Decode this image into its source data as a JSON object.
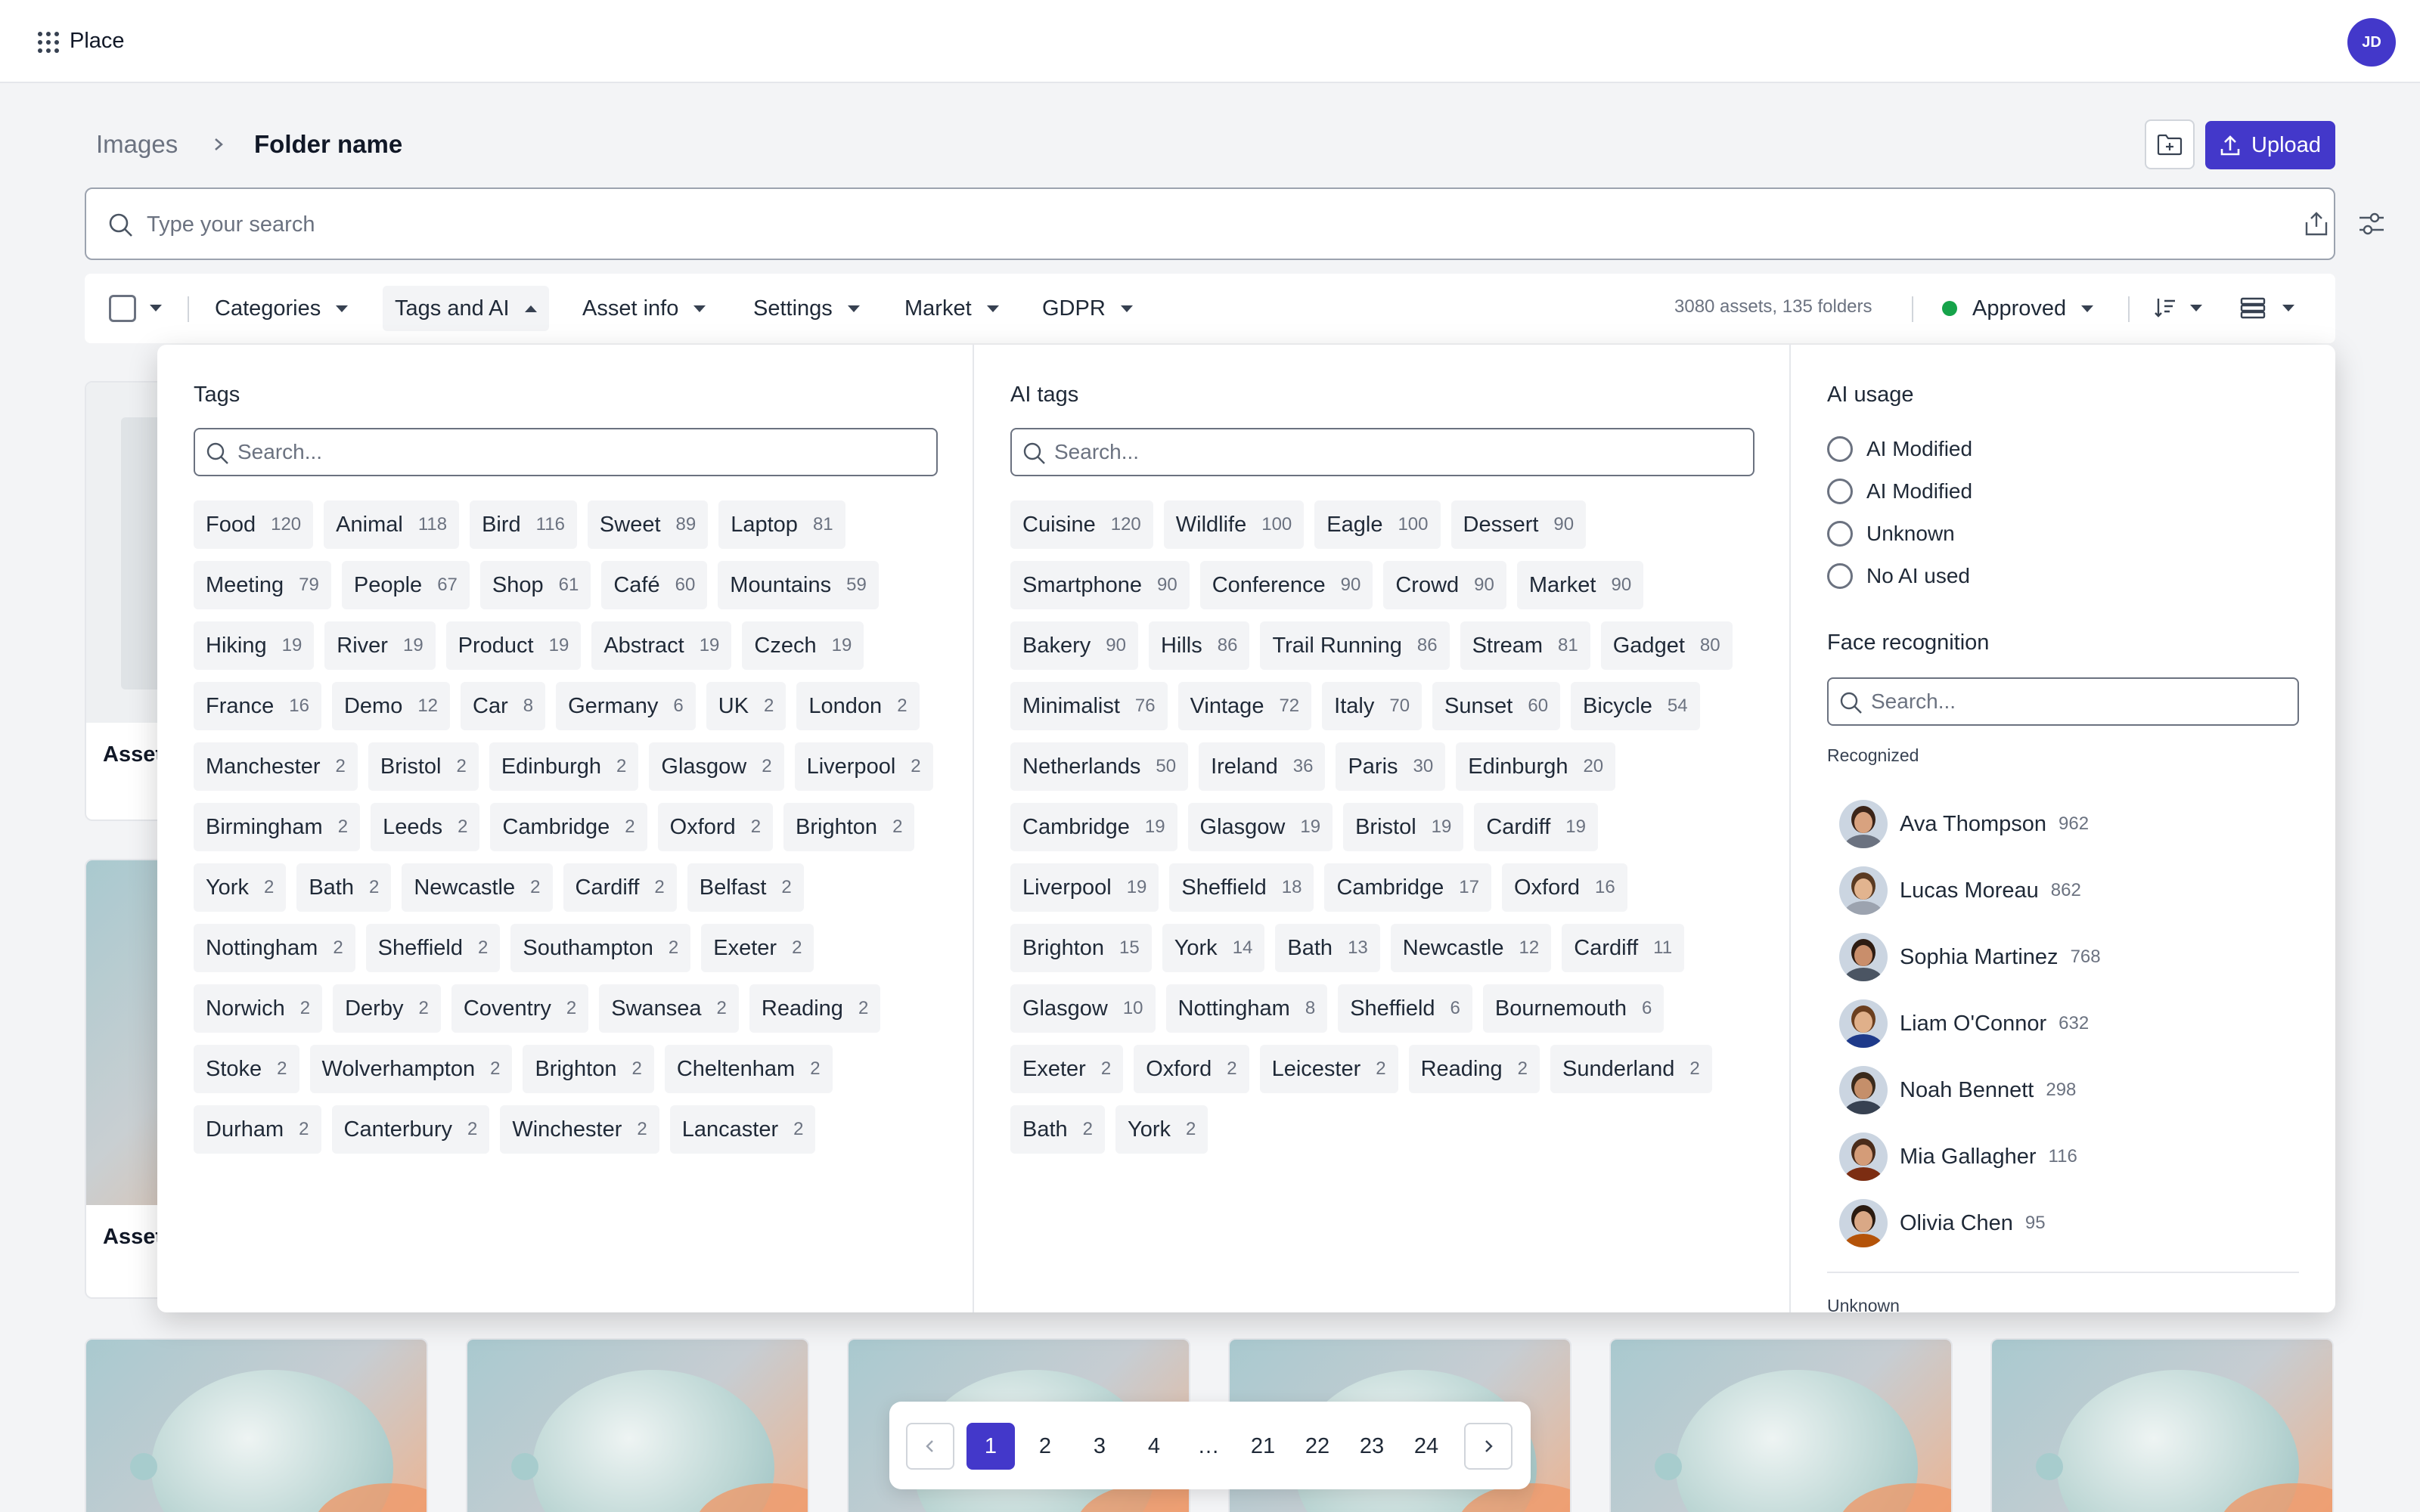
{
  "app": {
    "name": "Place",
    "user_initials": "JD"
  },
  "breadcrumb": {
    "root": "Images",
    "current": "Folder name"
  },
  "actions": {
    "upload_label": "Upload"
  },
  "search": {
    "placeholder": "Type your search"
  },
  "filters": {
    "items": [
      {
        "label": "Categories",
        "open": false
      },
      {
        "label": "Tags and AI",
        "open": true
      },
      {
        "label": "Asset info",
        "open": false
      },
      {
        "label": "Settings",
        "open": false
      },
      {
        "label": "Market",
        "open": false
      },
      {
        "label": "GDPR",
        "open": false
      }
    ],
    "asset_count": "3080 assets, 135 folders",
    "status": {
      "label": "Approved",
      "color": "#16a34a"
    }
  },
  "background_cards": {
    "asset_label": "Asset"
  },
  "panel": {
    "tags": {
      "title": "Tags",
      "search_placeholder": "Search...",
      "items": [
        {
          "label": "Food",
          "count": "120"
        },
        {
          "label": "Animal",
          "count": "118"
        },
        {
          "label": "Bird",
          "count": "116"
        },
        {
          "label": "Sweet",
          "count": "89"
        },
        {
          "label": "Laptop",
          "count": "81"
        },
        {
          "label": "Meeting",
          "count": "79"
        },
        {
          "label": "People",
          "count": "67"
        },
        {
          "label": "Shop",
          "count": "61"
        },
        {
          "label": "Café",
          "count": "60"
        },
        {
          "label": "Mountains",
          "count": "59"
        },
        {
          "label": "Hiking",
          "count": "19"
        },
        {
          "label": "River",
          "count": "19"
        },
        {
          "label": "Product",
          "count": "19"
        },
        {
          "label": "Abstract",
          "count": "19"
        },
        {
          "label": "Czech",
          "count": "19"
        },
        {
          "label": "France",
          "count": "16"
        },
        {
          "label": "Demo",
          "count": "12"
        },
        {
          "label": "Car",
          "count": "8"
        },
        {
          "label": "Germany",
          "count": "6"
        },
        {
          "label": "UK",
          "count": "2"
        },
        {
          "label": "London",
          "count": "2"
        },
        {
          "label": "Manchester",
          "count": "2"
        },
        {
          "label": "Bristol",
          "count": "2"
        },
        {
          "label": "Edinburgh",
          "count": "2"
        },
        {
          "label": "Glasgow",
          "count": "2"
        },
        {
          "label": "Liverpool",
          "count": "2"
        },
        {
          "label": "Birmingham",
          "count": "2"
        },
        {
          "label": "Leeds",
          "count": "2"
        },
        {
          "label": "Cambridge",
          "count": "2"
        },
        {
          "label": "Oxford",
          "count": "2"
        },
        {
          "label": "Brighton",
          "count": "2"
        },
        {
          "label": "York",
          "count": "2"
        },
        {
          "label": "Bath",
          "count": "2"
        },
        {
          "label": "Newcastle",
          "count": "2"
        },
        {
          "label": "Cardiff",
          "count": "2"
        },
        {
          "label": "Belfast",
          "count": "2"
        },
        {
          "label": "Nottingham",
          "count": "2"
        },
        {
          "label": "Sheffield",
          "count": "2"
        },
        {
          "label": "Southampton",
          "count": "2"
        },
        {
          "label": "Exeter",
          "count": "2"
        },
        {
          "label": "Norwich",
          "count": "2"
        },
        {
          "label": "Derby",
          "count": "2"
        },
        {
          "label": "Coventry",
          "count": "2"
        },
        {
          "label": "Swansea",
          "count": "2"
        },
        {
          "label": "Reading",
          "count": "2"
        },
        {
          "label": "Stoke",
          "count": "2"
        },
        {
          "label": "Wolverhampton",
          "count": "2"
        },
        {
          "label": "Brighton",
          "count": "2"
        },
        {
          "label": "Cheltenham",
          "count": "2"
        },
        {
          "label": "Durham",
          "count": "2"
        },
        {
          "label": "Canterbury",
          "count": "2"
        },
        {
          "label": "Winchester",
          "count": "2"
        },
        {
          "label": "Lancaster",
          "count": "2"
        }
      ]
    },
    "ai_tags": {
      "title": "AI tags",
      "search_placeholder": "Search...",
      "items": [
        {
          "label": "Cuisine",
          "count": "120"
        },
        {
          "label": "Wildlife",
          "count": "100"
        },
        {
          "label": "Eagle",
          "count": "100"
        },
        {
          "label": "Dessert",
          "count": "90"
        },
        {
          "label": "Smartphone",
          "count": "90"
        },
        {
          "label": "Conference",
          "count": "90"
        },
        {
          "label": "Crowd",
          "count": "90"
        },
        {
          "label": "Market",
          "count": "90"
        },
        {
          "label": "Bakery",
          "count": "90"
        },
        {
          "label": "Hills",
          "count": "86"
        },
        {
          "label": "Trail Running",
          "count": "86"
        },
        {
          "label": "Stream",
          "count": "81"
        },
        {
          "label": "Gadget",
          "count": "80"
        },
        {
          "label": "Minimalist",
          "count": "76"
        },
        {
          "label": "Vintage",
          "count": "72"
        },
        {
          "label": "Italy",
          "count": "70"
        },
        {
          "label": "Sunset",
          "count": "60"
        },
        {
          "label": "Bicycle",
          "count": "54"
        },
        {
          "label": "Netherlands",
          "count": "50"
        },
        {
          "label": "Ireland",
          "count": "36"
        },
        {
          "label": "Paris",
          "count": "30"
        },
        {
          "label": "Edinburgh",
          "count": "20"
        },
        {
          "label": "Cambridge",
          "count": "19"
        },
        {
          "label": "Glasgow",
          "count": "19"
        },
        {
          "label": "Bristol",
          "count": "19"
        },
        {
          "label": "Cardiff",
          "count": "19"
        },
        {
          "label": "Liverpool",
          "count": "19"
        },
        {
          "label": "Sheffield",
          "count": "18"
        },
        {
          "label": "Cambridge",
          "count": "17"
        },
        {
          "label": "Oxford",
          "count": "16"
        },
        {
          "label": "Brighton",
          "count": "15"
        },
        {
          "label": "York",
          "count": "14"
        },
        {
          "label": "Bath",
          "count": "13"
        },
        {
          "label": "Newcastle",
          "count": "12"
        },
        {
          "label": "Cardiff",
          "count": "11"
        },
        {
          "label": "Glasgow",
          "count": "10"
        },
        {
          "label": "Nottingham",
          "count": "8"
        },
        {
          "label": "Sheffield",
          "count": "6"
        },
        {
          "label": "Bournemouth",
          "count": "6"
        },
        {
          "label": "Exeter",
          "count": "2"
        },
        {
          "label": "Oxford",
          "count": "2"
        },
        {
          "label": "Leicester",
          "count": "2"
        },
        {
          "label": "Reading",
          "count": "2"
        },
        {
          "label": "Sunderland",
          "count": "2"
        },
        {
          "label": "Bath",
          "count": "2"
        },
        {
          "label": "York",
          "count": "2"
        }
      ]
    },
    "ai_usage": {
      "title": "AI usage",
      "options": [
        "AI Modified",
        "AI Modified",
        "Unknown",
        "No AI used"
      ]
    },
    "face_recognition": {
      "title": "Face recognition",
      "search_placeholder": "Search...",
      "recognized_label": "Recognized",
      "people": [
        {
          "name": "Ava Thompson",
          "count": "962"
        },
        {
          "name": "Lucas Moreau",
          "count": "862"
        },
        {
          "name": "Sophia Martinez",
          "count": "768"
        },
        {
          "name": "Liam O'Connor",
          "count": "632"
        },
        {
          "name": "Noah Bennett",
          "count": "298"
        },
        {
          "name": "Mia Gallagher",
          "count": "116"
        },
        {
          "name": "Olivia Chen",
          "count": "95"
        }
      ],
      "unknown_label": "Unknown"
    }
  },
  "pagination": {
    "pages": [
      "1",
      "2",
      "3",
      "4",
      "…",
      "21",
      "22",
      "23",
      "24"
    ],
    "current": "1"
  },
  "colors": {
    "accent": "#4338ca",
    "approved": "#16a34a"
  }
}
